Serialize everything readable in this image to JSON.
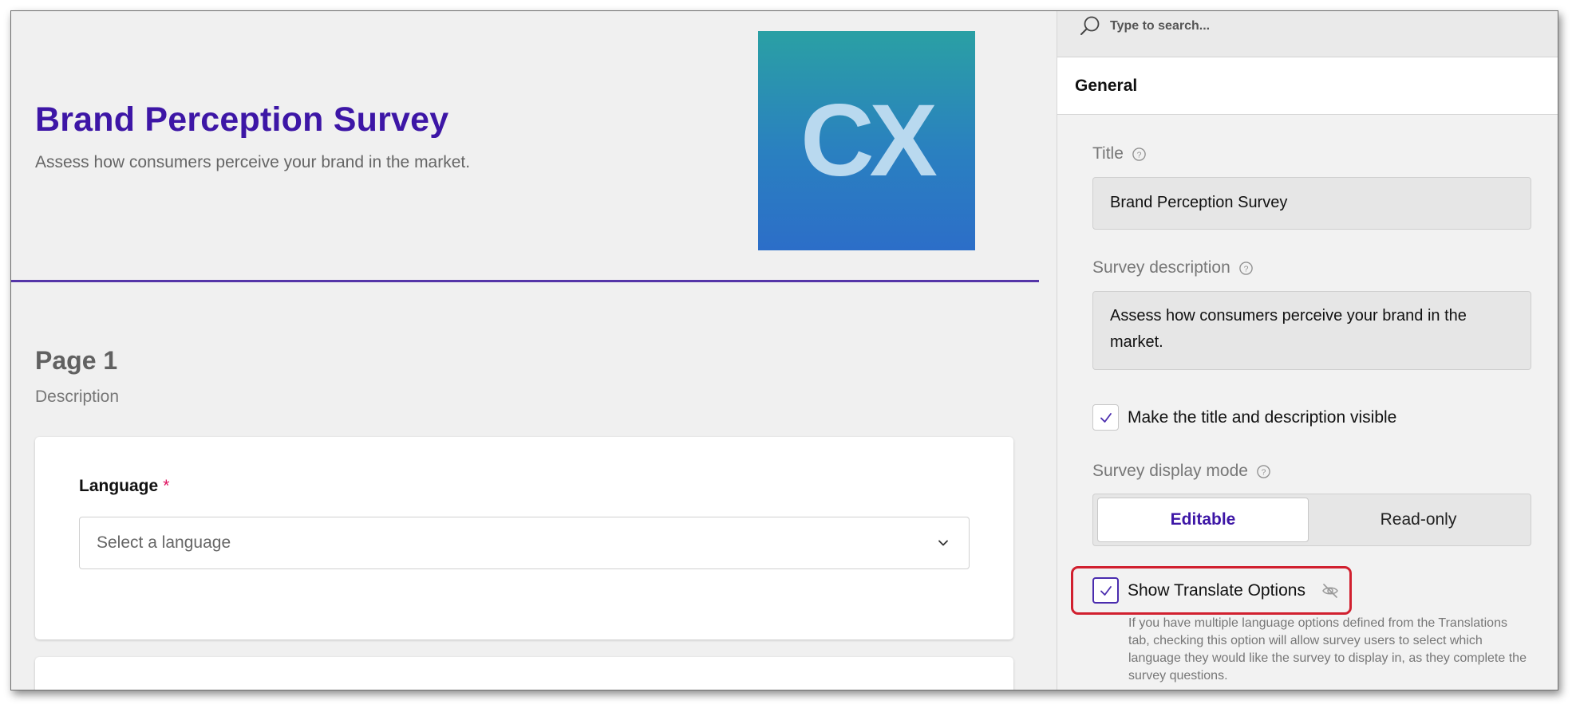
{
  "survey": {
    "title": "Brand Perception Survey",
    "description": "Assess how consumers perceive your brand in the market.",
    "logo_text": "CX",
    "page": {
      "title": "Page 1",
      "description": "Description"
    },
    "question": {
      "label": "Language",
      "required_mark": "*",
      "placeholder": "Select a language"
    }
  },
  "panel": {
    "search_placeholder": "Type to search...",
    "section": "General",
    "title_field": {
      "label": "Title",
      "value": "Brand Perception Survey"
    },
    "description_field": {
      "label": "Survey description",
      "value": "Assess how consumers perceive your brand in the market."
    },
    "visible_checkbox": {
      "label": "Make the title and description visible",
      "checked": true
    },
    "display_mode": {
      "label": "Survey display mode",
      "options": [
        "Editable",
        "Read-only"
      ],
      "selected": "Editable"
    },
    "translate_checkbox": {
      "label": "Show Translate Options",
      "checked": true,
      "help": "If you have multiple language options defined from the Translations tab, checking this option will allow survey users to select which language they would like the survey to display in, as they complete the survey questions."
    }
  },
  "colors": {
    "accent": "#3d16a6",
    "highlight": "#d1202f",
    "required": "#e0115f",
    "logo_top": "#2aa0a4",
    "logo_bottom": "#2c6ec8"
  },
  "icons": {
    "search": "search-icon",
    "help": "help-circle-icon",
    "chevron": "chevron-down-icon",
    "check": "check-icon",
    "visibility_off": "eye-off-icon"
  }
}
